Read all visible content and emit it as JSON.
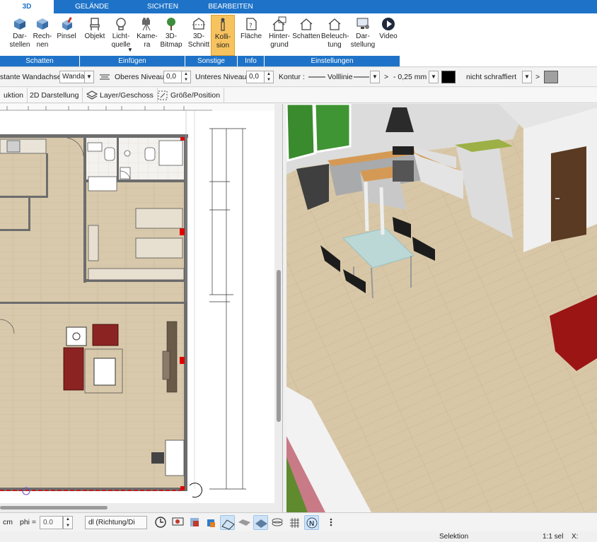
{
  "tabs": [
    {
      "label": "3D",
      "active": true
    },
    {
      "label": "GELÄNDE",
      "active": false
    },
    {
      "label": "SICHTEN",
      "active": false
    },
    {
      "label": "BEARBEITEN",
      "active": false
    }
  ],
  "ribbon": {
    "buttons": {
      "darstellen": "Dar-\nstellen",
      "rechnen": "Rech-\nnen",
      "pinsel": "Pinsel",
      "objekt": "Objekt",
      "lichtquelle": "Licht-\nquelle",
      "kamera": "Kame-\nra",
      "bitmap3d": "3D-\nBitmap",
      "schnitt3d": "3D-\nSchnitt",
      "kollision": "Kolli-\nsion",
      "flaeche": "Fläche",
      "hintergrund": "Hinter-\ngrund",
      "schatten": "Schatten",
      "beleuchtung": "Beleuch-\ntung",
      "darstellung": "Dar-\nstellung",
      "video": "Video"
    },
    "groups": {
      "schatten": "Schatten",
      "einfuegen": "Einfügen",
      "sonstige": "Sonstige",
      "info": "Info",
      "einstellungen": "Einstellungen"
    },
    "active_button": "kollision",
    "accent_color": "#1e73c8",
    "active_color": "#f7c35f"
  },
  "propbar": {
    "label_axis": "stante Wandachse",
    "axis_value": "Wanda",
    "label_upper": "Oberes Niveau",
    "upper_value": "0,0",
    "label_lower": "Unteres Niveau",
    "lower_value": "0,0",
    "label_contour": "Kontur :",
    "line_type": "Volllinie",
    "gt1": ">",
    "line_width": "- 0,25 mm -",
    "hatch": "nicht schraffiert",
    "gt2": ">"
  },
  "toolbar2": {
    "konstruktion": "uktion",
    "darstellung2d": "2D Darstellung",
    "layer": "Layer/Geschoss",
    "groesse": "Größe/Position"
  },
  "bottombar": {
    "unit": "cm",
    "phi_label": "phi =",
    "phi_value": "0.0",
    "direction": "dl (Richtung/Di"
  },
  "status": {
    "mode": "Selektion",
    "selection": "1:1 sel",
    "x_label": "X:"
  }
}
